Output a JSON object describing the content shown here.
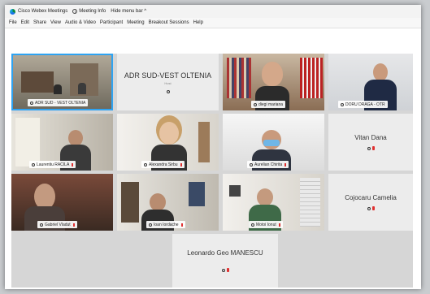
{
  "window": {
    "title": "Cisco Webex Meetings",
    "meeting_info": "Meeting Info",
    "hide_menu": "Hide menu bar ^"
  },
  "menu": [
    "File",
    "Edit",
    "Share",
    "View",
    "Audio & Video",
    "Participant",
    "Meeting",
    "Breakout Sessions",
    "Help"
  ],
  "participants": [
    {
      "label": "ADR SUD - VEST OLTENIA"
    },
    {
      "display_name": "ADR SUD-VEST OLTENIA",
      "sub": "Host"
    },
    {
      "label": "diegi mariana"
    },
    {
      "label": "DORU DRAGA - OTR"
    },
    {
      "label": "Laurentiu RACILA"
    },
    {
      "label": "Alexandra Sirbu"
    },
    {
      "label": "Aurelian Chirita"
    },
    {
      "display_name": "Vitan Dana"
    },
    {
      "label": "Gabriel Vladut"
    },
    {
      "label": "Ioan Iordache"
    },
    {
      "label": "Motoi Ionut"
    },
    {
      "display_name": "Cojocaru Camelia"
    },
    {
      "display_name": "Leonardo Geo MANESCU"
    }
  ],
  "colors": {
    "active_border": "#2ea3f2",
    "muted": "#e03030"
  }
}
